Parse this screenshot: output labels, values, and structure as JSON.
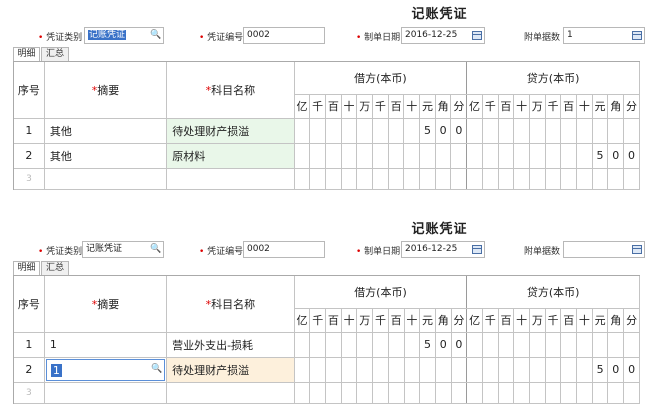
{
  "panels": [
    {
      "title": "记账凭证",
      "form": {
        "type_label": "凭证类别",
        "type_value": "记账凭证",
        "number_label": "凭证编号",
        "number_value": "0002",
        "date_label": "制单日期",
        "date_value": "2016-12-25",
        "attach_label": "附单据数",
        "attach_value": "1"
      },
      "tabs": [
        {
          "label": "明细"
        },
        {
          "label": "汇总"
        }
      ],
      "headers": {
        "seq": "序号",
        "summary": "摘要",
        "subject": "科目名称",
        "debit": "借方(本币)",
        "credit": "贷方(本币)",
        "digits": [
          "亿",
          "千",
          "百",
          "十",
          "万",
          "千",
          "百",
          "十",
          "元",
          "角",
          "分"
        ]
      },
      "rows": [
        {
          "seq": "1",
          "summary": "其他",
          "subject": "待处理财产损溢",
          "debit": [
            "",
            "",
            "",
            "",
            "",
            "",
            "",
            "5",
            "0",
            "0"
          ],
          "credit": [
            "",
            "",
            "",
            "",
            "",
            "",
            "",
            "",
            "",
            "",
            ""
          ]
        },
        {
          "seq": "2",
          "summary": "其他",
          "subject": "原材料",
          "debit": [
            "",
            "",
            "",
            "",
            "",
            "",
            "",
            "",
            "",
            "",
            ""
          ],
          "credit": [
            "",
            "",
            "",
            "",
            "",
            "",
            "",
            "",
            "5",
            "0",
            "0"
          ]
        },
        {
          "seq": "3"
        }
      ]
    },
    {
      "title": "记账凭证",
      "form": {
        "type_label": "凭证类别",
        "type_value": "记账凭证",
        "number_label": "凭证编号",
        "number_value": "0002",
        "date_label": "制单日期",
        "date_value": "2016-12-25",
        "attach_label": "附单据数",
        "attach_value": ""
      },
      "tabs": [
        {
          "label": "明细"
        },
        {
          "label": "汇总"
        }
      ],
      "headers": {
        "seq": "序号",
        "summary": "摘要",
        "subject": "科目名称",
        "debit": "借方(本币)",
        "credit": "贷方(本币)",
        "digits": [
          "亿",
          "千",
          "百",
          "十",
          "万",
          "千",
          "百",
          "十",
          "元",
          "角",
          "分"
        ]
      },
      "rows": [
        {
          "seq": "1",
          "summary": "1",
          "subject": "营业外支出-损耗",
          "debit": [
            "",
            "",
            "",
            "",
            "",
            "",
            "",
            "5",
            "0",
            "0"
          ],
          "credit": [
            "",
            "",
            "",
            "",
            "",
            "",
            "",
            "",
            "",
            "",
            ""
          ]
        },
        {
          "seq": "2",
          "summary": "1",
          "subject": "待处理财产损溢",
          "debit": [
            "",
            "",
            "",
            "",
            "",
            "",
            "",
            "",
            "",
            "",
            ""
          ],
          "credit": [
            "",
            "",
            "",
            "",
            "",
            "",
            "",
            "",
            "5",
            "0",
            "0"
          ]
        },
        {
          "seq": "3"
        }
      ]
    }
  ]
}
